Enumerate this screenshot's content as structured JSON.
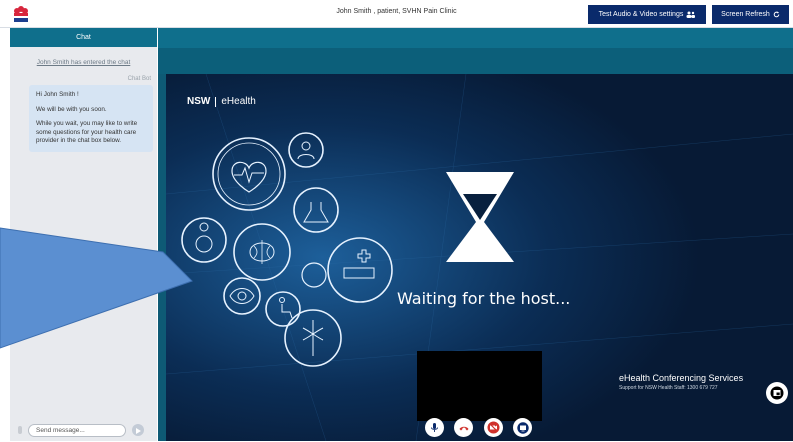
{
  "topbar": {
    "title": "John Smith , patient, SVHN Pain Clinic",
    "audio_button": "Test Audio & Video settings",
    "refresh_button": "Screen Refresh"
  },
  "chat": {
    "header": "Chat",
    "entered_text": "John Smith has entered the chat",
    "bot_label": "Chat Bot",
    "messages": [
      "Hi John Smith !",
      "We will be with you soon.",
      "While you wait, you may like to write some questions for your health care provider in the chat box below."
    ],
    "input_placeholder": "Send message..."
  },
  "video": {
    "brand_nsw": "NSW",
    "brand_ehealth": "eHealth",
    "waiting_text": "Waiting for the host...",
    "service_title": "eHealth Conferencing Services",
    "service_sub": "Support for NSW Health Staff: 1300 679 727"
  },
  "colors": {
    "accent_dark": "#0a2a6b",
    "teal": "#0f6f8c",
    "bubble": "#d6e4f3",
    "hangup": "#d0322c"
  },
  "icons": [
    "nsw-logo-icon",
    "people-icon",
    "refresh-icon",
    "send-icon",
    "microphone-icon",
    "hangup-icon",
    "camera-off-icon",
    "screen-share-icon",
    "picture-in-picture-icon",
    "hourglass-icon"
  ]
}
